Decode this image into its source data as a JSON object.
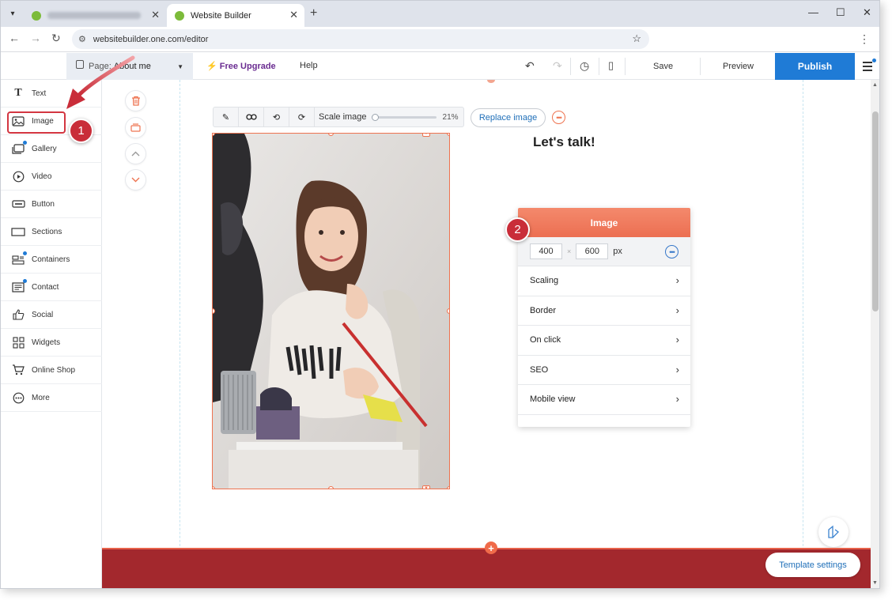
{
  "browser": {
    "tabs": [
      {
        "title": ""
      },
      {
        "title": "Website Builder"
      }
    ],
    "new_tab": "+",
    "url": "websitebuilder.one.com/editor"
  },
  "editor_bar": {
    "page_label": "Page:",
    "page_name": "About me",
    "upgrade": "Free Upgrade",
    "help": "Help",
    "save": "Save",
    "preview": "Preview",
    "publish": "Publish"
  },
  "sidebar": {
    "items": [
      {
        "label": "Text",
        "icon": "text-icon"
      },
      {
        "label": "Image",
        "icon": "image-icon"
      },
      {
        "label": "Gallery",
        "icon": "gallery-icon"
      },
      {
        "label": "Video",
        "icon": "video-icon"
      },
      {
        "label": "Button",
        "icon": "button-icon"
      },
      {
        "label": "Sections",
        "icon": "sections-icon"
      },
      {
        "label": "Containers",
        "icon": "containers-icon"
      },
      {
        "label": "Contact",
        "icon": "contact-icon"
      },
      {
        "label": "Social",
        "icon": "social-icon"
      },
      {
        "label": "Widgets",
        "icon": "widgets-icon"
      },
      {
        "label": "Online Shop",
        "icon": "shop-icon"
      },
      {
        "label": "More",
        "icon": "more-icon"
      }
    ]
  },
  "image_toolbar": {
    "scale_label": "Scale image",
    "scale_value": "21%",
    "scale_fraction": 0.0,
    "replace": "Replace image"
  },
  "content": {
    "heading": "Let's talk!"
  },
  "panel": {
    "title": "Image",
    "width": "400",
    "height": "600",
    "times": "×",
    "unit": "px",
    "rows": [
      {
        "label": "Scaling"
      },
      {
        "label": "Border"
      },
      {
        "label": "On click"
      },
      {
        "label": "SEO"
      },
      {
        "label": "Mobile view"
      }
    ]
  },
  "footer": {
    "template_settings": "Template settings"
  },
  "annotations": {
    "step1": "1",
    "step2": "2"
  },
  "colors": {
    "accent": "#ee7350",
    "publish": "#1f7bd6",
    "footer": "#a3282d",
    "annotation": "#c92d39",
    "upgrade": "#6a2c91"
  }
}
